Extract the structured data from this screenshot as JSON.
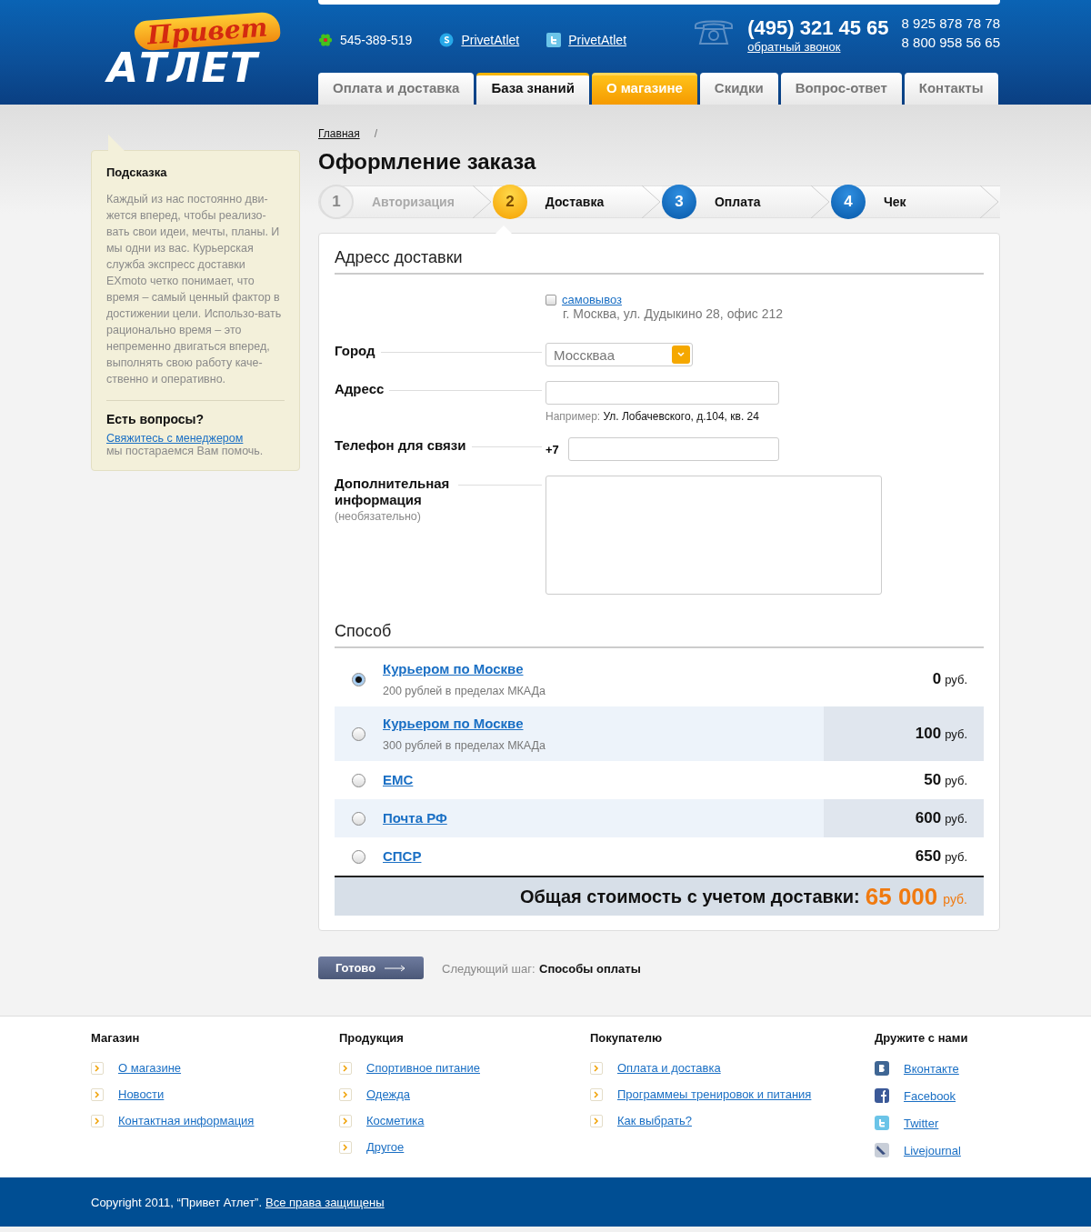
{
  "header": {
    "logo": {
      "top": "Привет",
      "bottom": "АТЛЕТ"
    },
    "contacts": [
      {
        "kind": "icq",
        "text": "545-389-519",
        "link": false
      },
      {
        "kind": "skype",
        "text": "PrivetAtlet",
        "link": true
      },
      {
        "kind": "twitter",
        "text": "PrivetAtlet",
        "link": true
      }
    ],
    "phone": {
      "main": "(495) 321 45 65",
      "callback": "обратный звонок",
      "others": [
        "8 925 878 78 78",
        "8 800 958 56 65"
      ]
    },
    "tabs": [
      {
        "label": "Оплата и доставка",
        "selected": false,
        "emphasized": false
      },
      {
        "label": "База знаний",
        "selected": false,
        "emphasized": true
      },
      {
        "label": "О магазине",
        "selected": true,
        "emphasized": false
      },
      {
        "label": "Скидки",
        "selected": false,
        "emphasized": false
      },
      {
        "label": "Вопрос-ответ",
        "selected": false,
        "emphasized": false
      },
      {
        "label": "Контакты",
        "selected": false,
        "emphasized": false
      }
    ]
  },
  "sidebar": {
    "title": "Подсказка",
    "text": "Каждый из нас постоянно дви-жется вперед, чтобы реализо-вать свои идеи, мечты, планы. И мы одни из вас. Курьерская служба экспресс доставки EXmoto четко понимает, что время – самый ценный фактор в достижении цели. Использо-вать рационально время – это непременно двигаться вперед, выполнять свою работу каче-ственно и оперативно.",
    "questions_title": "Есть вопросы?",
    "contact_link": "Свяжитесь с менеджером",
    "contact_note": "мы постараемся Вам помочь."
  },
  "breadcrumbs": [
    {
      "label": "Главная"
    }
  ],
  "separator": "/",
  "title": "Оформление заказа",
  "steps": [
    {
      "number": "1",
      "label": "Авторизация",
      "completed": true,
      "selected": false
    },
    {
      "number": "2",
      "label": "Доставка",
      "completed": false,
      "selected": true
    },
    {
      "number": "3",
      "label": "Оплата",
      "completed": false,
      "selected": false
    },
    {
      "number": "4",
      "label": "Чек",
      "completed": false,
      "selected": false
    }
  ],
  "address": {
    "heading": "Адресс доставки",
    "pickup": {
      "label": "самовывоз",
      "checked": false,
      "address": "г. Москва, ул. Дудыкино 28, офис 212"
    },
    "city": {
      "label": "Город",
      "value": "Мосскваа"
    },
    "street": {
      "label": "Адресс",
      "example_label": "Например:",
      "example": "Ул. Лобачевского, д.104, кв. 24"
    },
    "phone": {
      "label": "Телефон для связи",
      "prefix": "+7"
    },
    "extra": {
      "label": "Дополнительная информация",
      "note": "(необязательно)"
    }
  },
  "delivery": {
    "heading": "Способ",
    "methods": [
      {
        "name": "Курьером по Москве",
        "note": "200 рублей в пределах МКАДа",
        "price": "0",
        "currency": "руб.",
        "selected": true
      },
      {
        "name": "Курьером по Москве",
        "note": "300 рублей в пределах МКАДа",
        "price": "100",
        "currency": "руб.",
        "selected": false
      },
      {
        "name": "ЕМС",
        "price": "50",
        "currency": "руб.",
        "selected": false
      },
      {
        "name": "Почта РФ",
        "price": "600",
        "currency": "руб.",
        "selected": false
      },
      {
        "name": "СПСР",
        "price": "650",
        "currency": "руб.",
        "selected": false
      }
    ],
    "total": {
      "label": "Общая стоимость с учетом доставки:",
      "amount": "65 000",
      "currency": "руб."
    }
  },
  "actions": {
    "button": "Готово",
    "next_label": "Следующий шаг:",
    "next_value": "Способы оплаты"
  },
  "footer": {
    "columns": [
      {
        "title": "Магазин",
        "links": [
          {
            "label": "О магазине"
          },
          {
            "label": "Новости"
          },
          {
            "label": "Контактная информация"
          }
        ]
      },
      {
        "title": "Продукция",
        "links": [
          {
            "label": "Спортивное питание"
          },
          {
            "label": "Одежда"
          },
          {
            "label": "Косметика"
          },
          {
            "label": "Другое"
          }
        ]
      },
      {
        "title": "Покупателю",
        "links": [
          {
            "label": "Оплата и доставка"
          },
          {
            "label": "Программеы тренировок и питания"
          },
          {
            "label": "Как выбрать?"
          }
        ]
      },
      {
        "title": "Дружите с нами",
        "links": [
          {
            "label": "Вконтакте",
            "kind": "vk"
          },
          {
            "label": "Facebook",
            "kind": "facebook"
          },
          {
            "label": "Twitter",
            "kind": "twitter"
          },
          {
            "label": "Livejournal",
            "kind": "livejournal"
          }
        ]
      }
    ],
    "copyright": "Copyright 2011, “Привет Атлет”.",
    "rights": "Все права защищены"
  }
}
